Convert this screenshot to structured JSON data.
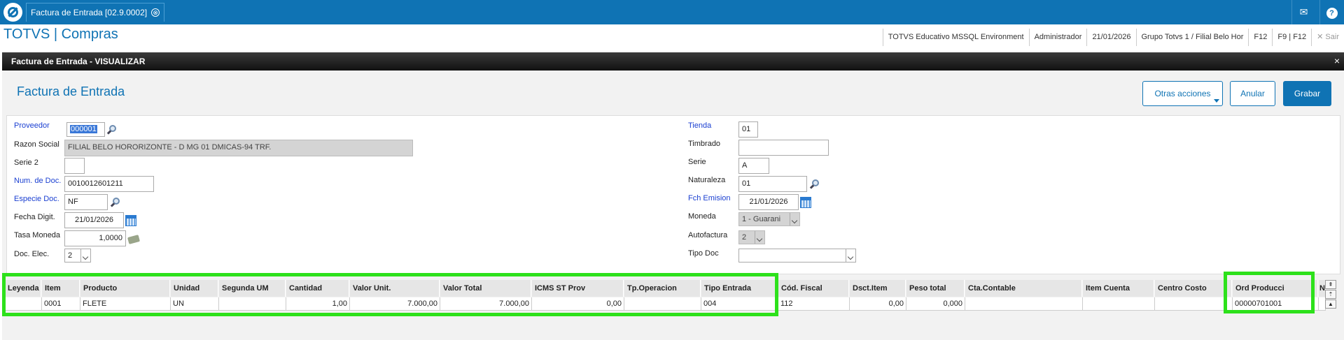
{
  "topbar": {
    "tab_label": "Factura de Entrada [02.9.0002]",
    "tab_close": "⊗"
  },
  "header": {
    "app_title": "TOTVS | Compras",
    "environment": "TOTVS Educativo MSSQL Environment",
    "user": "Administrador",
    "date": "21/01/2026",
    "branch": "Grupo Totvs 1 / Filial Belo Hor",
    "f12": "F12",
    "f9f12": "F9 | F12",
    "exit": "✕  Sair"
  },
  "dialog": {
    "title": "Factura de Entrada - VISUALIZAR",
    "close": "×",
    "form_title": "Factura de Entrada",
    "buttons": {
      "otras": "Otras acciones",
      "anular": "Anular",
      "grabar": "Grabar"
    }
  },
  "form": {
    "proveedor": {
      "label": "Proveedor",
      "value": "000001"
    },
    "razon_social": {
      "label": "Razon Social",
      "value": "FILIAL BELO HORORIZONTE - D MG 01 DMICAS-94 TRF."
    },
    "serie2": {
      "label": "Serie 2",
      "value": ""
    },
    "num_doc": {
      "label": "Num. de Doc.",
      "value": "0010012601211"
    },
    "especie_doc": {
      "label": "Especie Doc.",
      "value": "NF"
    },
    "fecha_digit": {
      "label": "Fecha Digit.",
      "value": "21/01/2026"
    },
    "tasa_moneda": {
      "label": "Tasa Moneda",
      "value": "1,0000"
    },
    "doc_elec": {
      "label": "Doc. Elec.",
      "value": "2"
    },
    "tienda": {
      "label": "Tienda",
      "value": "01"
    },
    "timbrado": {
      "label": "Timbrado",
      "value": ""
    },
    "serie": {
      "label": "Serie",
      "value": "A"
    },
    "naturaleza": {
      "label": "Naturaleza",
      "value": "01"
    },
    "fch_emision": {
      "label": "Fch Emision",
      "value": "21/01/2026"
    },
    "moneda": {
      "label": "Moneda",
      "value": "1 - Guarani"
    },
    "autofactura": {
      "label": "Autofactura",
      "value": "2"
    },
    "tipo_doc": {
      "label": "Tipo Doc",
      "value": ""
    }
  },
  "grid": {
    "headers": [
      "Leyenda",
      "Item",
      "Producto",
      "Unidad",
      "Segunda UM",
      "Cantidad",
      "Valor Unit.",
      "Valor Total",
      "ICMS ST Prov",
      "Tp.Operacion",
      "Tipo Entrada",
      "Cód. Fiscal",
      "Dsct.Item",
      "Peso total",
      "Cta.Contable",
      "Item Cuenta",
      "Centro Costo",
      "Ord Producci",
      "Nu"
    ],
    "row": [
      "",
      "0001",
      "FLETE",
      "UN",
      "",
      "1,00",
      "7.000,00",
      "7.000,00",
      "0,00",
      "",
      "004",
      "112",
      "0,00",
      "0,000",
      "",
      "",
      "",
      "00000701001",
      ""
    ]
  },
  "colors": {
    "brand": "#0f73b4",
    "highlight": "#2de11b",
    "required_label": "#1a3fd1"
  }
}
